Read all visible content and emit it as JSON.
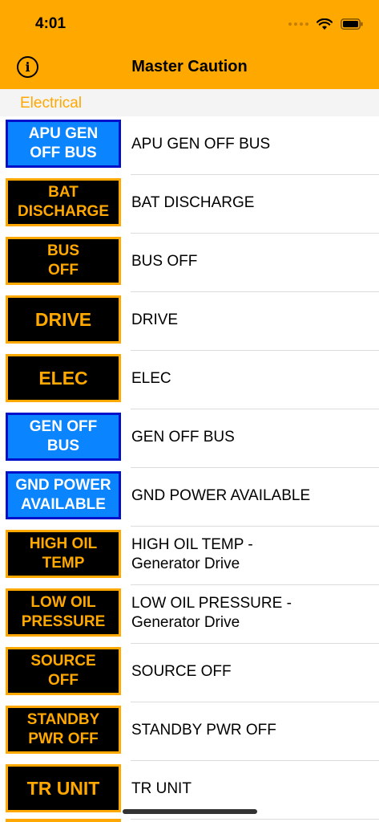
{
  "status_bar": {
    "time": "4:01"
  },
  "nav": {
    "title": "Master Caution",
    "info_icon": "info-circle-icon"
  },
  "section": {
    "title": "Electrical"
  },
  "colors": {
    "accent": "#FFA800",
    "blue_fill": "#0A84FF",
    "blue_border": "#0011CC",
    "black_fill": "#000000"
  },
  "items": [
    {
      "badge": "APU GEN\nOFF BUS",
      "style": "blue",
      "label": "APU GEN OFF BUS"
    },
    {
      "badge": "BAT\nDISCHARGE",
      "style": "black",
      "label": "BAT DISCHARGE"
    },
    {
      "badge": "BUS\nOFF",
      "style": "black",
      "label": "BUS OFF"
    },
    {
      "badge": "DRIVE",
      "style": "black big",
      "label": "DRIVE"
    },
    {
      "badge": "ELEC",
      "style": "black big",
      "label": "ELEC"
    },
    {
      "badge": "GEN OFF\nBUS",
      "style": "blue",
      "label": "GEN OFF BUS"
    },
    {
      "badge": "GND POWER\nAVAILABLE",
      "style": "blue",
      "label": "GND POWER AVAILABLE"
    },
    {
      "badge": "HIGH OIL\nTEMP",
      "style": "black",
      "label": "HIGH OIL TEMP -\nGenerator Drive"
    },
    {
      "badge": "LOW OIL\nPRESSURE",
      "style": "black",
      "label": "LOW OIL PRESSURE -\nGenerator Drive"
    },
    {
      "badge": "SOURCE\nOFF",
      "style": "black",
      "label": "SOURCE OFF"
    },
    {
      "badge": "STANDBY\nPWR OFF",
      "style": "black",
      "label": "STANDBY PWR OFF"
    },
    {
      "badge": "TR UNIT",
      "style": "black big",
      "label": "TR UNIT"
    }
  ]
}
